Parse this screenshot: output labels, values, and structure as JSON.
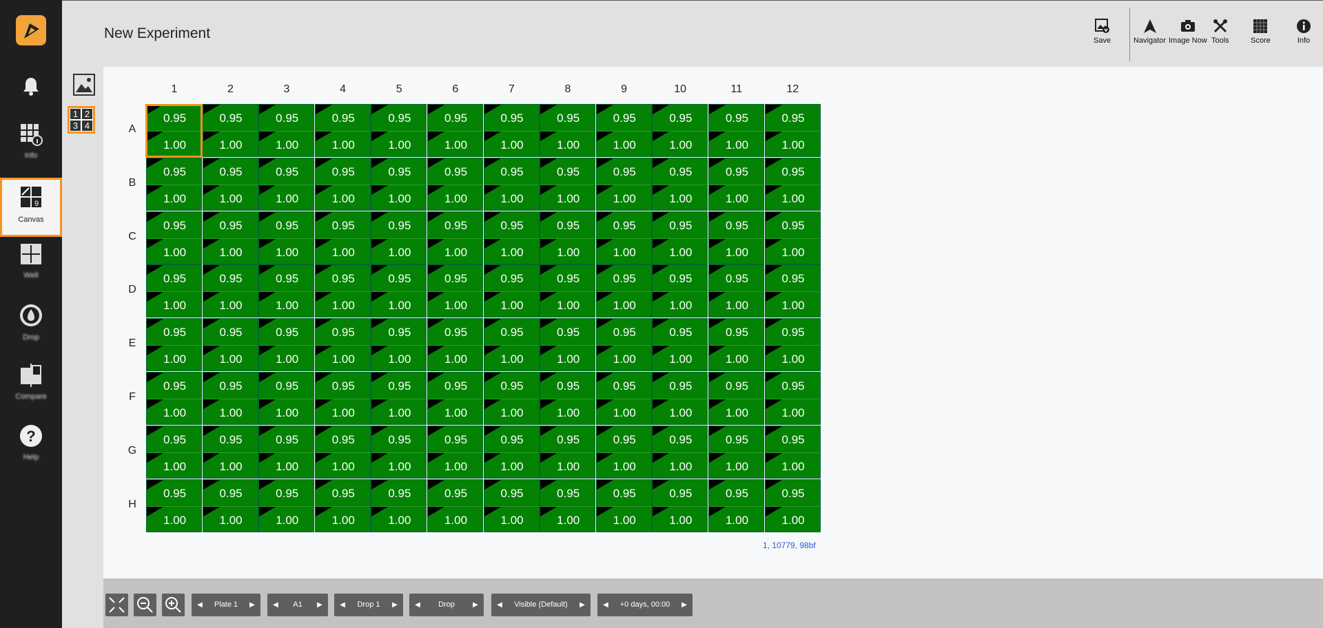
{
  "app": {
    "title": "New Experiment"
  },
  "sidebar": {
    "items": [
      {
        "name": "notifications",
        "label": ""
      },
      {
        "name": "info",
        "label": "Info"
      },
      {
        "name": "canvas",
        "label": "Canvas"
      },
      {
        "name": "well",
        "label": "Well"
      },
      {
        "name": "drop",
        "label": "Drop"
      },
      {
        "name": "compare",
        "label": "Compare"
      },
      {
        "name": "help",
        "label": "Help"
      }
    ]
  },
  "toolbar": {
    "save": "Save",
    "navigator": "Navigator",
    "image_now": "Image Now",
    "tools": "Tools",
    "score": "Score",
    "info": "Info"
  },
  "plate": {
    "columns": [
      "1",
      "2",
      "3",
      "4",
      "5",
      "6",
      "7",
      "8",
      "9",
      "10",
      "11",
      "12"
    ],
    "rows": [
      "A",
      "B",
      "C",
      "D",
      "E",
      "F",
      "G",
      "H"
    ],
    "top_value": "0.95",
    "bottom_value": "1.00",
    "selected_well": "A1",
    "well_color": "#048204"
  },
  "status_text": "1, 10779, 98bf",
  "bottom": {
    "plate": "Plate 1",
    "well": "A1",
    "drop": "Drop 1",
    "view": "Drop",
    "visibility": "Visible (Default)",
    "time": "+0 days, 00:00"
  },
  "colors": {
    "accent": "#f7931e",
    "sidebar": "#1f1f1f",
    "well": "#048204"
  }
}
